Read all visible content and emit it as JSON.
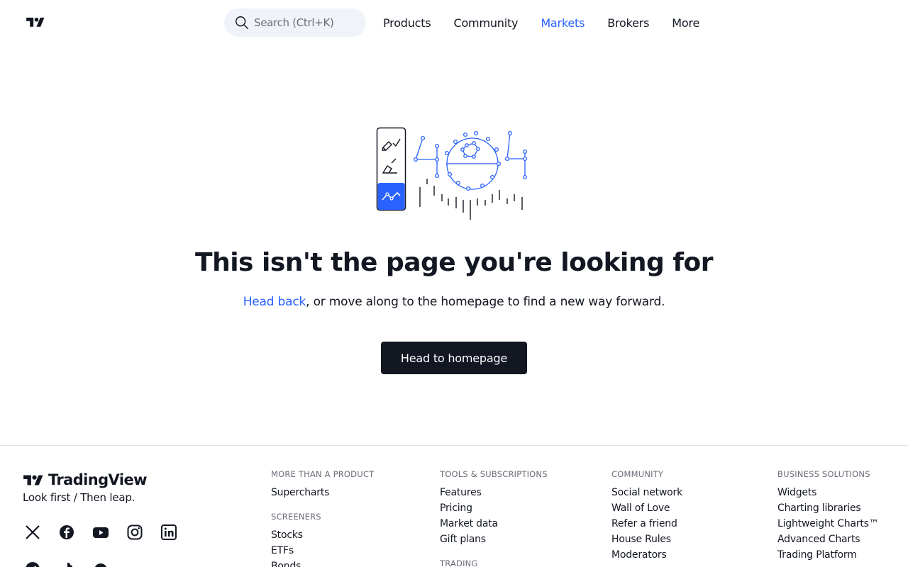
{
  "header": {
    "search_placeholder": "Search (Ctrl+K)",
    "nav": [
      {
        "label": "Products",
        "active": false
      },
      {
        "label": "Community",
        "active": false
      },
      {
        "label": "Markets",
        "active": true
      },
      {
        "label": "Brokers",
        "active": false
      },
      {
        "label": "More",
        "active": false
      }
    ]
  },
  "main": {
    "headline": "This isn't the page you're looking for",
    "sub_link": "Head back",
    "sub_rest": ", or move along to the homepage to find a new way forward.",
    "cta_label": "Head to homepage"
  },
  "footer": {
    "brand_name": "TradingView",
    "tagline": "Look first / Then leap.",
    "social": [
      "x-icon",
      "facebook-icon",
      "youtube-icon",
      "instagram-icon",
      "linkedin-icon",
      "telegram-icon",
      "tiktok-icon",
      "reddit-icon"
    ],
    "columns": [
      {
        "groups": [
          {
            "heading": "MORE THAN A PRODUCT",
            "links": [
              "Supercharts"
            ]
          },
          {
            "heading": "SCREENERS",
            "links": [
              "Stocks",
              "ETFs",
              "Bonds"
            ]
          }
        ]
      },
      {
        "groups": [
          {
            "heading": "TOOLS & SUBSCRIPTIONS",
            "links": [
              "Features",
              "Pricing",
              "Market data",
              "Gift plans"
            ]
          },
          {
            "heading": "TRADING",
            "links": []
          }
        ]
      },
      {
        "groups": [
          {
            "heading": "COMMUNITY",
            "links": [
              "Social network",
              "Wall of Love",
              "Refer a friend",
              "House Rules",
              "Moderators"
            ]
          }
        ]
      },
      {
        "groups": [
          {
            "heading": "BUSINESS SOLUTIONS",
            "links": [
              "Widgets",
              "Charting libraries",
              "Lightweight Charts™",
              "Advanced Charts",
              "Trading Platform"
            ]
          }
        ]
      }
    ]
  },
  "colors": {
    "accent": "#2962ff",
    "text": "#131722",
    "muted": "#6a6d78",
    "search_bg": "#f0f3fa",
    "border": "#e0e3eb"
  }
}
